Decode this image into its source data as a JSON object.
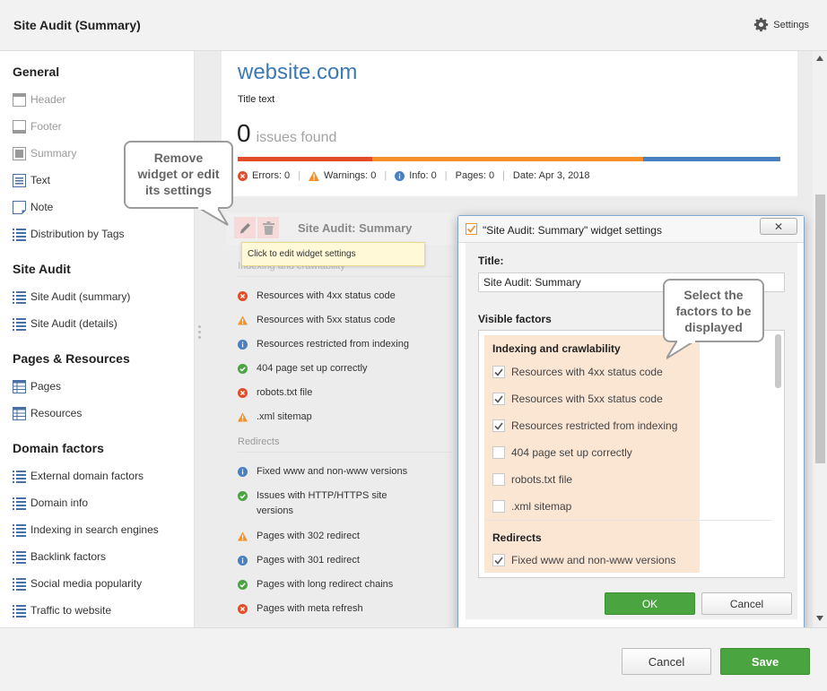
{
  "header": {
    "title": "Site Audit (Summary)",
    "settings_label": "Settings"
  },
  "sidebar": {
    "general": {
      "title": "General",
      "items": [
        {
          "label": "Header",
          "icon": "header-icon",
          "dim": true
        },
        {
          "label": "Footer",
          "icon": "footer-icon",
          "dim": true
        },
        {
          "label": "Summary",
          "icon": "summary-icon",
          "dim": true
        },
        {
          "label": "Text",
          "icon": "text-icon",
          "dim": false
        },
        {
          "label": "Note",
          "icon": "note-icon",
          "dim": false
        },
        {
          "label": "Distribution by Tags",
          "icon": "list-icon",
          "dim": false
        }
      ]
    },
    "site_audit": {
      "title": "Site Audit",
      "items": [
        {
          "label": "Site Audit (summary)",
          "icon": "list-icon"
        },
        {
          "label": "Site Audit (details)",
          "icon": "list-icon"
        }
      ]
    },
    "pages_resources": {
      "title": "Pages & Resources",
      "items": [
        {
          "label": "Pages",
          "icon": "table-icon"
        },
        {
          "label": "Resources",
          "icon": "table-icon"
        }
      ]
    },
    "domain_factors": {
      "title": "Domain factors",
      "items": [
        {
          "label": "External domain factors",
          "icon": "list-icon"
        },
        {
          "label": "Domain info",
          "icon": "list-icon"
        },
        {
          "label": "Indexing in search engines",
          "icon": "list-icon"
        },
        {
          "label": "Backlink factors",
          "icon": "list-icon"
        },
        {
          "label": "Social media popularity",
          "icon": "list-icon"
        },
        {
          "label": "Traffic to website",
          "icon": "list-icon"
        }
      ]
    }
  },
  "preview": {
    "site": "website.com",
    "title_text": "Title text",
    "issues_count": "0",
    "issues_label": "issues found",
    "bar_colors": [
      "#e34c26",
      "#f49025",
      "#4a7fc1"
    ],
    "stats": {
      "errors": "Errors: 0",
      "warnings": "Warnings: 0",
      "info": "Info: 0",
      "pages": "Pages: 0",
      "date": "Date: Apr 3, 2018"
    },
    "widget_title": "Site Audit: Summary",
    "tooltip": "Click to edit widget settings",
    "group1": "Indexing and crawlability",
    "group1_rows": [
      {
        "text": "Resources with 4xx status code",
        "status": "error"
      },
      {
        "text": "Resources with 5xx status code",
        "status": "warning"
      },
      {
        "text": "Resources restricted from indexing",
        "status": "info"
      },
      {
        "text": "404 page set up correctly",
        "status": "ok"
      },
      {
        "text": "robots.txt file",
        "status": "error"
      },
      {
        "text": ".xml sitemap",
        "status": "warning"
      }
    ],
    "group2": "Redirects",
    "group2_rows": [
      {
        "text": "Fixed www and non-www versions",
        "status": "info"
      },
      {
        "text": "Issues with HTTP/HTTPS site versions",
        "status": "ok"
      },
      {
        "text": "Pages with 302 redirect",
        "status": "warning"
      },
      {
        "text": "Pages with 301 redirect",
        "status": "info"
      },
      {
        "text": "Pages with long redirect chains",
        "status": "ok"
      },
      {
        "text": "Pages with meta refresh",
        "status": "error"
      }
    ]
  },
  "callouts": {
    "remove": "Remove widget or edit its settings",
    "select": "Select the factors to be displayed"
  },
  "dialog": {
    "title": "\"Site Audit: Summary\" widget settings",
    "title_label": "Title:",
    "title_value": "Site Audit: Summary",
    "visible_label": "Visible factors",
    "group1": "Indexing and crawlability",
    "group1_items": [
      {
        "label": "Resources with 4xx status code",
        "checked": true
      },
      {
        "label": "Resources with 5xx status code",
        "checked": true
      },
      {
        "label": "Resources restricted from indexing",
        "checked": true
      },
      {
        "label": "404 page set up correctly",
        "checked": false
      },
      {
        "label": "robots.txt file",
        "checked": false
      },
      {
        "label": ".xml sitemap",
        "checked": false
      }
    ],
    "group2": "Redirects",
    "group2_items": [
      {
        "label": "Fixed www and non-www versions",
        "checked": true
      }
    ],
    "ok": "OK",
    "cancel": "Cancel"
  },
  "footer": {
    "cancel": "Cancel",
    "save": "Save"
  },
  "colors": {
    "error": "#e34c26",
    "warning": "#f49025",
    "info": "#4a7fc1",
    "ok": "#4aa43f",
    "accent": "#3d7ab5"
  }
}
